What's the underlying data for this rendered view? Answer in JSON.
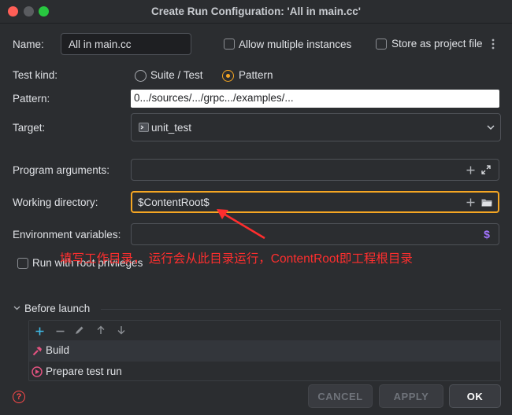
{
  "window": {
    "title": "Create Run Configuration: 'All in main.cc'"
  },
  "name": {
    "label": "Name:",
    "value": "All in main.cc"
  },
  "options": {
    "allow_multiple": "Allow multiple instances",
    "store_project_file": "Store as project file"
  },
  "test_kind": {
    "label": "Test kind:",
    "suite_test": "Suite / Test",
    "pattern": "Pattern",
    "selected": "Pattern"
  },
  "pattern": {
    "label": "Pattern:",
    "value": "0.../sources/.../grpc.../examples/..."
  },
  "target": {
    "label": "Target:",
    "value": "unit_test"
  },
  "program_arguments": {
    "label": "Program arguments:",
    "value": ""
  },
  "working_directory": {
    "label": "Working directory:",
    "value": "$ContentRoot$"
  },
  "environment_variables": {
    "label": "Environment variables:",
    "value": ""
  },
  "root_privileges": {
    "label": "Run with root privileges"
  },
  "annotation": {
    "text": "填写工作目录， 运行会从此目录运行，ContentRoot即工程根目录"
  },
  "before_launch": {
    "label": "Before launch",
    "items": [
      {
        "label": "Build",
        "icon": "hammer-icon"
      },
      {
        "label": "Prepare test run",
        "icon": "prepare-test-icon"
      }
    ]
  },
  "buttons": {
    "cancel": "CANCEL",
    "apply": "APPLY",
    "ok": "OK"
  },
  "colors": {
    "accent": "#f5a623",
    "annotation": "#ff2e2e",
    "background": "#2b2d30",
    "field": "#1e1f22"
  }
}
